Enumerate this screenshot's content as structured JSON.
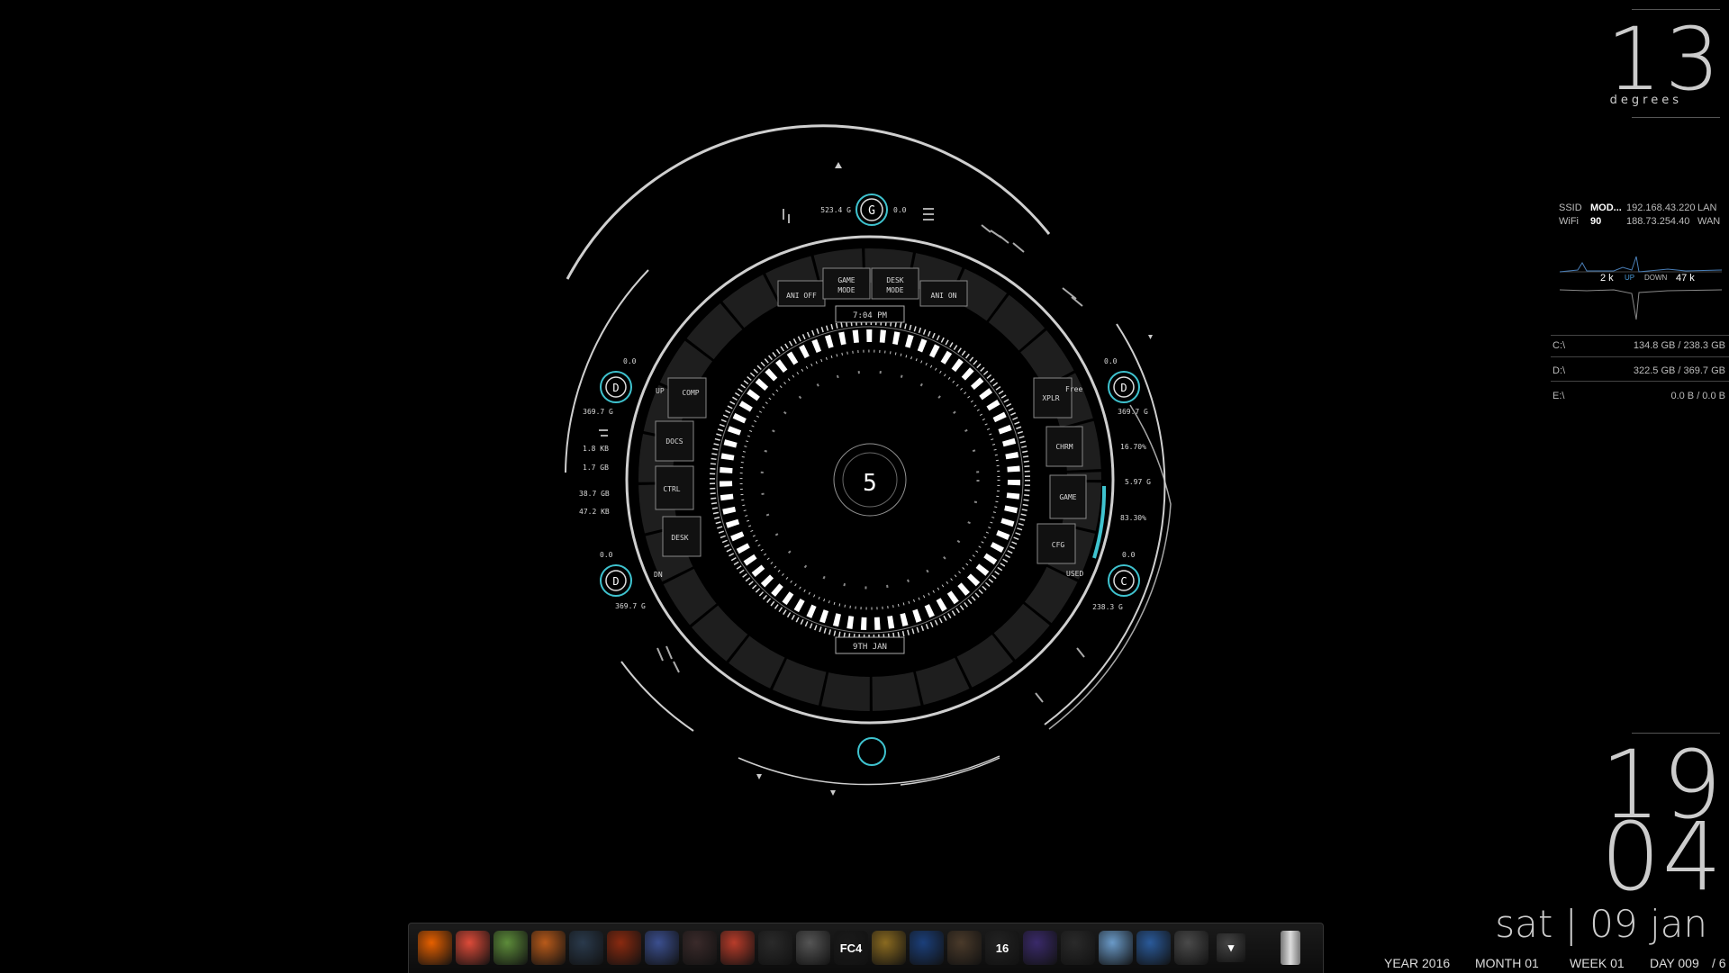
{
  "hud": {
    "center_number": "5",
    "time": "7:04 PM",
    "date_short": "9TH JAN",
    "top_button": "G",
    "top_left_value": "523.4 G",
    "top_right_value": "0.0",
    "buttons_top": [
      "ANI OFF",
      "GAME\nMODE",
      "DESK\nMODE",
      "ANI ON"
    ],
    "buttons_left": [
      "COMP",
      "DOCS",
      "CTRL",
      "DESK"
    ],
    "buttons_right": [
      "XPLR",
      "CHRM",
      "GAME",
      "CFG"
    ],
    "label_up": "UP",
    "label_dn": "DN",
    "label_free": "Free",
    "label_used": "USED",
    "left_stats": [
      "1.8 KB",
      "1.7 GB",
      "38.7 GB",
      "47.2 KB"
    ],
    "right_stats": [
      "16.70%",
      "5.97 G",
      "83.30%"
    ],
    "drive_tl": {
      "letter": "D",
      "top": "0.0",
      "bottom": "369.7 G"
    },
    "drive_bl": {
      "letter": "D",
      "top": "0.0",
      "bottom": "369.7 G"
    },
    "drive_tr": {
      "letter": "D",
      "top": "0.0",
      "bottom": "369.7 G"
    },
    "drive_br": {
      "letter": "C",
      "top": "0.0",
      "bottom": "238.3 G"
    },
    "accent": "#3fc3cf"
  },
  "weather": {
    "temperature": "13",
    "unit_label": "degrees"
  },
  "network": {
    "ssid_label": "SSID",
    "ssid_value": "MOD...",
    "wifi_label": "WiFi",
    "wifi_value": "90",
    "lan_ip": "192.168.43.220",
    "lan_label": "LAN",
    "wan_ip": "188.73.254.40",
    "wan_label": "WAN",
    "up_value": "2 k",
    "up_label": "UP",
    "down_label": "DOWN",
    "down_value": "47 k"
  },
  "drives": [
    {
      "letter": "C:\\",
      "usage": "134.8 GB / 238.3 GB"
    },
    {
      "letter": "D:\\",
      "usage": "322.5 GB / 369.7 GB"
    },
    {
      "letter": "E:\\",
      "usage": "0.0 B / 0.0 B"
    }
  ],
  "clock": {
    "hour": "19",
    "minute": "04",
    "date": "sat | 09 jan"
  },
  "calendar_stats": {
    "year": "YEAR 2016",
    "month": "MONTH 01",
    "week": "WEEK 01",
    "day": "DAY 009",
    "extra": "/ 6"
  },
  "dock": {
    "items": [
      {
        "name": "firefox-icon",
        "label": "",
        "color": "#e66000"
      },
      {
        "name": "chrome-icon",
        "label": "",
        "color": "#dd4b39"
      },
      {
        "name": "minecraft-icon",
        "label": "",
        "color": "#5d8c3a"
      },
      {
        "name": "rocket-icon",
        "label": "",
        "color": "#b85a1a"
      },
      {
        "name": "steam-like-icon",
        "label": "",
        "color": "#2a3a4c"
      },
      {
        "name": "game-warrior-icon",
        "label": "",
        "color": "#8a2a10"
      },
      {
        "name": "game-poster-icon",
        "label": "",
        "color": "#3b4f8f"
      },
      {
        "name": "game-dark-icon",
        "label": "",
        "color": "#3a2a2a"
      },
      {
        "name": "game-tank-icon",
        "label": "",
        "color": "#b83c2a"
      },
      {
        "name": "witcher-icon",
        "label": "",
        "color": "#2a2a2a"
      },
      {
        "name": "game-knight-icon",
        "label": "",
        "color": "#555555"
      },
      {
        "name": "farcry4-icon",
        "label": "FC4",
        "color": "#1a1a1a"
      },
      {
        "name": "game-gold-icon",
        "label": "",
        "color": "#8a6a20"
      },
      {
        "name": "battlenet-icon",
        "label": "",
        "color": "#1b3f7a"
      },
      {
        "name": "game-monster-icon",
        "label": "",
        "color": "#4a3a2a"
      },
      {
        "name": "game-16-icon",
        "label": "16",
        "color": "#222222"
      },
      {
        "name": "video-editor-icon",
        "label": "",
        "color": "#3a2a6a"
      },
      {
        "name": "winamp-icon",
        "label": "",
        "color": "#2a2a2a"
      },
      {
        "name": "globe-icon",
        "label": "",
        "color": "#6a9ac8"
      },
      {
        "name": "thunderbird-icon",
        "label": "",
        "color": "#2a5a9a"
      },
      {
        "name": "diamond-icon",
        "label": "",
        "color": "#4a4a4a"
      },
      {
        "name": "dock-menu-icon",
        "label": "",
        "color": "#444444"
      },
      {
        "name": "trash-icon",
        "label": "",
        "color": "#1a1a1a"
      }
    ]
  }
}
